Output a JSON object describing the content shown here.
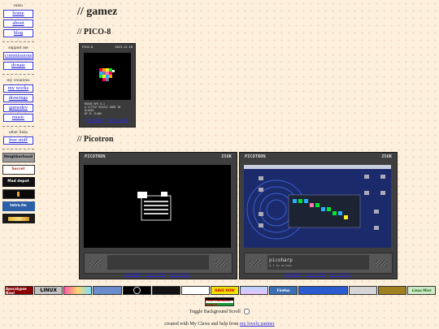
{
  "sidebar": {
    "sections": [
      {
        "label": "main",
        "items": [
          "home",
          "about",
          "blog"
        ]
      },
      {
        "label": "support me",
        "items": [
          "commissions",
          "donate"
        ]
      },
      {
        "label": "my creations",
        "items": [
          "my works",
          "drawings",
          "gamedev",
          "music"
        ]
      },
      {
        "label": "other links",
        "items": [
          "free stuff"
        ]
      }
    ],
    "badges": [
      "Neighborhood",
      "Secret",
      "Mad depot",
      "",
      "tetra.fm",
      ""
    ]
  },
  "page": {
    "title": "// gamez",
    "pico8": {
      "heading": "// PICO-8",
      "cart_header_left": "PICO-8",
      "cart_header_right": "2023-12-18",
      "cart_label_line1": "MOUSE RPG 0.1",
      "cart_label_line2": "A LITTLE PUZZLE GAME IN BLACKS",
      "cart_label_line3": "BY M. CLAWS",
      "links": {
        "download": "download",
        "sep": " - ",
        "view": "view on itch"
      }
    },
    "picotron": {
      "heading": "// Picotron",
      "carts": [
        {
          "header_left": "PICOTRON",
          "header_right": "256K",
          "footer_title": "",
          "footer_sub": "",
          "links": {
            "download": "download",
            "bbs": "view on bbs",
            "itch": "view on itch"
          }
        },
        {
          "header_left": "PICOTRON",
          "header_right": "256K",
          "footer_title": "picoharp",
          "footer_sub": "0.3 by mclaws",
          "links": {
            "download": "download",
            "bbs": "view on bbs",
            "itch": "view on itch"
          }
        }
      ],
      "link_sep": " - "
    }
  },
  "footer": {
    "badges": [
      "Apocalypse Now!",
      "LINUX",
      "",
      "",
      "",
      "",
      "",
      "RAVE NOW",
      "",
      "Firefox",
      "",
      "",
      "",
      "Linux Mint"
    ],
    "badge2_label": "Free Palestine Now!!!",
    "toggle_label": "Toggle Background Scroll",
    "credit_prefix": "created with My Claws and help from ",
    "credit_link": "my lovely partner"
  }
}
